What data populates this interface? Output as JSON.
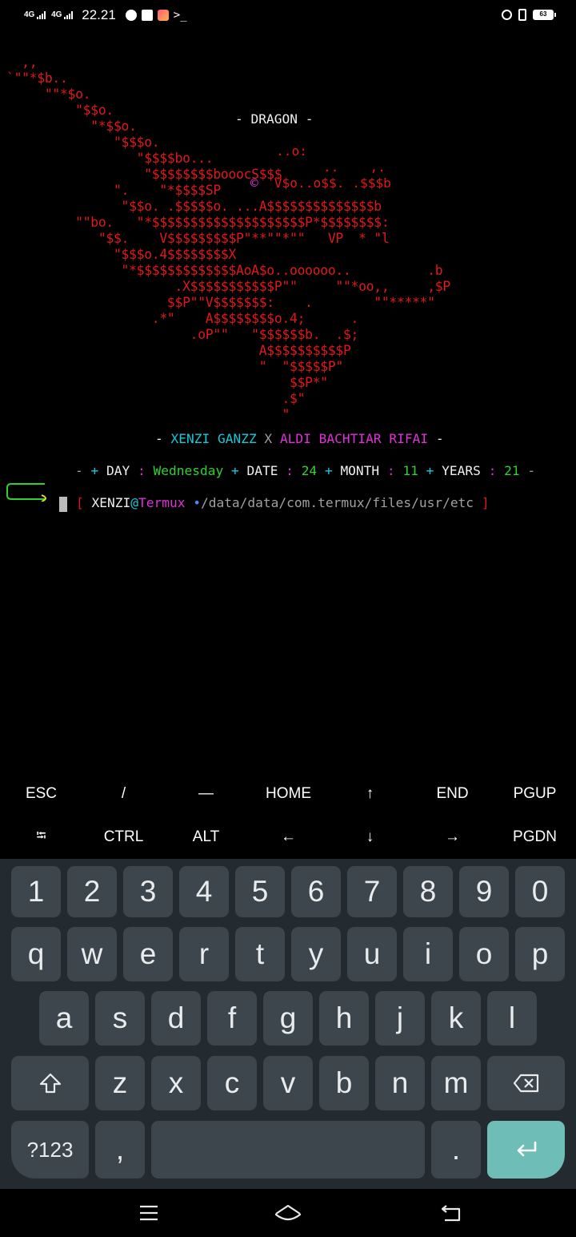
{
  "status_bar": {
    "network1": "4G",
    "network2": "4G",
    "time": "22.21",
    "prompt_glyph": ">_",
    "battery": "63",
    "icons": [
      "whatsapp-icon",
      "gmail-icon",
      "shopee-icon",
      "terminal-icon",
      "alarm-icon",
      "vibrate-icon",
      "battery-icon"
    ]
  },
  "terminal": {
    "ascii_art": [
      "  ,,",
      "`\"\"*$b..",
      "     \"\"*$o.",
      "         \"$$o.",
      "           \"*$$o.",
      "              \"$$$o.",
      "                 \"$$$$bo...",
      "                  \"$$$$$$$$booocS$$$",
      "              \".    \"*$$$$SP",
      "               \"$$o. .$$$$$o. ...A$$$$$$$$$$$$$$b",
      "         \"\"bo.   \"*$$$$$$$$$$$$$$$$$$$$P*$$$$$$$$:",
      "            \"$$.    V$$$$$$$$$P\"**\"\"*\"\"   VP  * \"l",
      "              \"$$$o.4$$$$$$$$X",
      "               \"*$$$$$$$$$$$$$AoA$o..oooooo..          .b",
      "                      .X$$$$$$$$$$$P\"\"     \"\"*oo,,     ,$P",
      "                     $$P\"\"V$$$$$$$:    .        \"\"*****\"",
      "                   .*\"    A$$$$$$$$o.4;      .",
      "                        .oP\"\"   \"$$$$$$b.  .$;",
      "                                 A$$$$$$$$$$P",
      "                                 \"  \"$$$$$P\"",
      "                                     $$P*\"",
      "                                    .$\"",
      "                                    \""
    ],
    "dragon_title": "- DRAGON -",
    "ascii_extra_1": "..o:",
    "ascii_extra_2": "..    ,.",
    "ascii_copyright": "©",
    "ascii_extra_3": " V$o..o$$. .$$$b",
    "credit": {
      "dash_left": "- ",
      "name1": "XENZI GANZZ",
      "x": " X ",
      "name2": "ALDI BACHTIAR RIFAI",
      "dash_right": " -"
    },
    "date_line": {
      "dash": "- ",
      "plus": "+ ",
      "day_label": "DAY",
      "colon": " : ",
      "day_value": "Wednesday",
      "date_label": "DATE",
      "date_value": "24",
      "month_label": "MONTH",
      "month_value": "11",
      "years_label": "YEARS",
      "years_value": "21",
      "dash_end": " -"
    },
    "prompt": {
      "open_bracket": "[",
      "user": "XENZI",
      "at": "@",
      "host": "Termux",
      "bullet": "•",
      "path": "/data/data/com.termux/files/usr/etc",
      "close_bracket": "]"
    }
  },
  "extra_keys": {
    "row1": [
      "ESC",
      "/",
      "—",
      "HOME",
      "↑",
      "END",
      "PGUP"
    ],
    "row2": [
      "⭾",
      "CTRL",
      "ALT",
      "←",
      "↓",
      "→",
      "PGDN"
    ]
  },
  "keyboard": {
    "row_numbers": [
      "1",
      "2",
      "3",
      "4",
      "5",
      "6",
      "7",
      "8",
      "9",
      "0"
    ],
    "row_q": [
      "q",
      "w",
      "e",
      "r",
      "t",
      "y",
      "u",
      "i",
      "o",
      "p"
    ],
    "row_a": [
      "a",
      "s",
      "d",
      "f",
      "g",
      "h",
      "j",
      "k",
      "l"
    ],
    "row_z": [
      "z",
      "x",
      "c",
      "v",
      "b",
      "n",
      "m"
    ],
    "shift_icon": "shift-icon",
    "backspace_icon": "backspace-icon",
    "symbols_label": "?123",
    "comma": ",",
    "period": ".",
    "enter_icon": "enter-icon"
  },
  "navigation_bar": {
    "icons": [
      "menu-icon",
      "home-icon",
      "back-icon"
    ]
  }
}
